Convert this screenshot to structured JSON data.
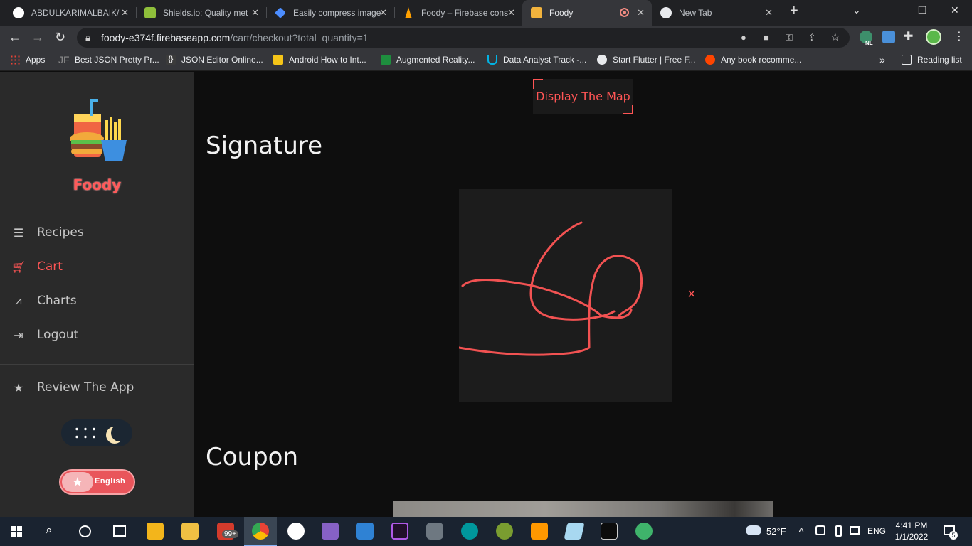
{
  "browser": {
    "tabs": [
      {
        "title": "ABDULKARIMALBAIK/",
        "favicon": "github-icon"
      },
      {
        "title": "Shields.io: Quality met",
        "favicon": "shields-icon"
      },
      {
        "title": "Easily compress image",
        "favicon": "compress-icon"
      },
      {
        "title": "Foody – Firebase cons",
        "favicon": "firebase-icon"
      },
      {
        "title": "Foody",
        "favicon": "foody-icon",
        "active": true
      },
      {
        "title": "New Tab",
        "favicon": "chrome-icon"
      }
    ],
    "url_host": "foody-e374f.firebaseapp.com",
    "url_path": "/cart/checkout?total_quantity=1",
    "bookmarks": [
      "Apps",
      "Best JSON Pretty Pr...",
      "JSON Editor Online...",
      "Android How to Int...",
      "Augmented Reality...",
      "Data Analyst Track -...",
      "Start Flutter | Free F...",
      "Any book recomme..."
    ],
    "reading_list": "Reading list",
    "bookmark_more": "»",
    "jf_badge": "JF",
    "ext_badge": "NL"
  },
  "sidebar": {
    "brand": "Foody",
    "nav": [
      {
        "label": "Recipes",
        "icon": "recipes-icon"
      },
      {
        "label": "Cart",
        "icon": "cart-icon",
        "active": true
      },
      {
        "label": "Charts",
        "icon": "chart-icon"
      },
      {
        "label": "Logout",
        "icon": "logout-icon"
      }
    ],
    "review": {
      "label": "Review The App",
      "icon": "star-icon"
    },
    "language_label": "English"
  },
  "main": {
    "map_button": "Display The Map",
    "signature_heading": "Signature",
    "clear_symbol": "×",
    "coupon_heading": "Coupon"
  },
  "taskbar": {
    "notification_count": "99+",
    "temperature": "52°F",
    "language": "ENG",
    "time": "4:41 PM",
    "date": "1/1/2022",
    "notif_badge": "5"
  },
  "colors": {
    "accent": "#ff5555",
    "sidebar_bg": "#2a2a2a",
    "main_bg": "#0e0e0e"
  }
}
